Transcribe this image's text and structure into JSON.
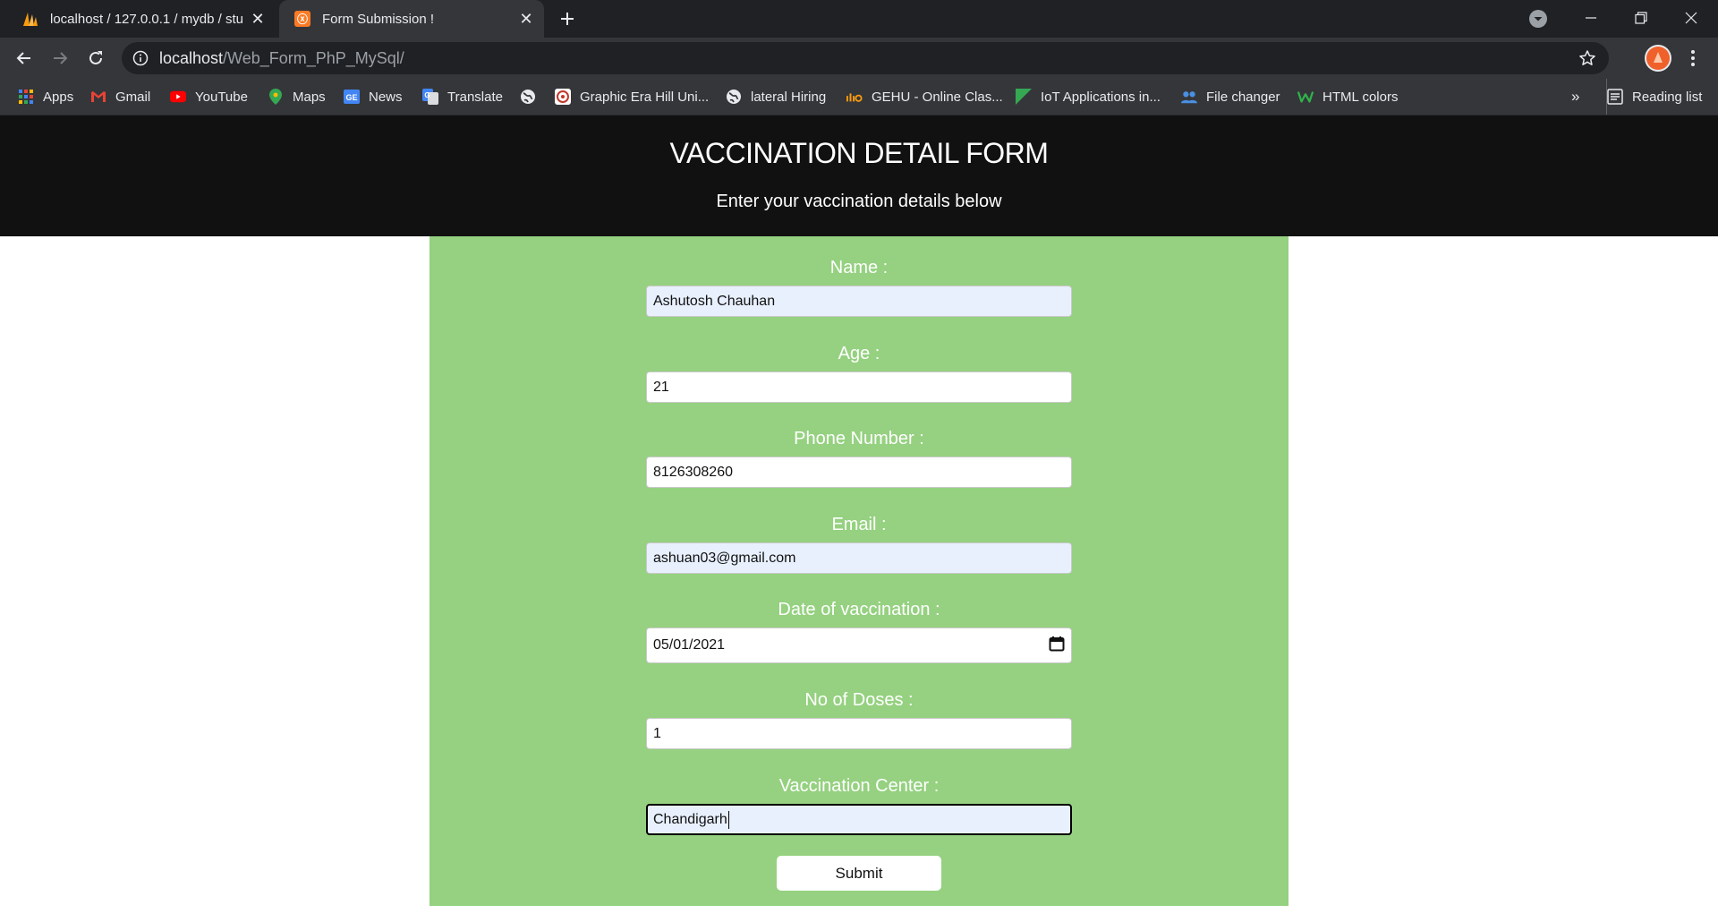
{
  "browser": {
    "tabs": [
      {
        "title": "localhost / 127.0.0.1 / mydb / stu",
        "favicon": "phpmyadmin-icon",
        "active": false
      },
      {
        "title": "Form Submission !",
        "favicon": "xampp-icon",
        "active": true
      }
    ],
    "url_host": "localhost",
    "url_path": "/Web_Form_PhP_MySql/",
    "bookmarks": [
      {
        "label": "Apps",
        "icon": "apps-grid-icon"
      },
      {
        "label": "Gmail",
        "icon": "gmail-icon"
      },
      {
        "label": "YouTube",
        "icon": "youtube-icon"
      },
      {
        "label": "Maps",
        "icon": "maps-icon"
      },
      {
        "label": "News",
        "icon": "news-icon"
      },
      {
        "label": "Translate",
        "icon": "translate-icon"
      },
      {
        "label": "",
        "icon": "globe-icon"
      },
      {
        "label": "Graphic Era Hill Uni...",
        "icon": "university-icon"
      },
      {
        "label": "lateral Hiring",
        "icon": "globe-icon"
      },
      {
        "label": "GEHU - Online Clas...",
        "icon": "gehu-icon"
      },
      {
        "label": "IoT Applications in...",
        "icon": "flag-icon"
      },
      {
        "label": "File changer",
        "icon": "people-icon"
      },
      {
        "label": "HTML colors",
        "icon": "w-icon"
      }
    ],
    "bookmarks_overflow": "»",
    "reading_list": "Reading list"
  },
  "page": {
    "title": "VACCINATION DETAIL FORM",
    "subtitle": "Enter your vaccination details below"
  },
  "form": {
    "name_label": "Name :",
    "name_value": "Ashutosh Chauhan",
    "age_label": "Age :",
    "age_value": "21",
    "phone_label": "Phone Number :",
    "phone_value": "8126308260",
    "email_label": "Email :",
    "email_value": "ashuan03@gmail.com",
    "date_label": "Date of vaccination :",
    "date_value": "05/01/2021",
    "doses_label": "No of Doses :",
    "doses_value": "1",
    "center_label": "Vaccination Center :",
    "center_value": "Chandigarh",
    "submit_label": "Submit"
  },
  "colors": {
    "header_bg": "#111111",
    "form_bg": "#95d180",
    "autofill_bg": "#e8f0fe",
    "chrome_bg": "#202124",
    "toolbar_bg": "#35363a"
  }
}
